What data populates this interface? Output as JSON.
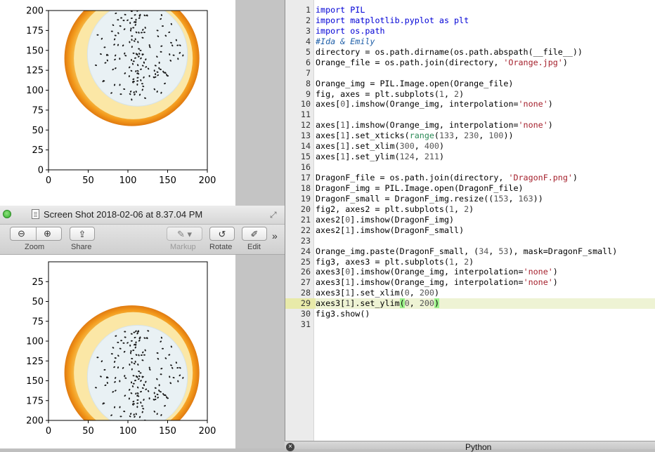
{
  "plot_top": {
    "chart_data": {
      "type": "image",
      "x_ticks": [
        "0",
        "50",
        "100",
        "150",
        "200"
      ],
      "y_ticks": [
        "0",
        "25",
        "50",
        "75",
        "100",
        "125",
        "150",
        "175",
        "200"
      ],
      "xlim": [
        0,
        200
      ],
      "ylim": [
        200,
        0
      ]
    },
    "image_icon": "orange-with-dragonfruit-image"
  },
  "plot_bottom": {
    "chart_data": {
      "type": "image",
      "x_ticks": [
        "0",
        "50",
        "100",
        "150",
        "200"
      ],
      "y_ticks": [
        "200",
        "175",
        "150",
        "125",
        "100",
        "75",
        "50",
        "25"
      ],
      "xlim": [
        0,
        200
      ],
      "ylim": [
        0,
        200
      ]
    },
    "image_icon": "orange-with-dragonfruit-image"
  },
  "preview": {
    "title": "Screen Shot 2018-02-06 at 8.37.04 PM",
    "toolbar": {
      "zoom_label": "Zoom",
      "share_label": "Share",
      "markup_label": "Markup",
      "rotate_label": "Rotate",
      "edit_label": "Edit"
    }
  },
  "editor": {
    "line_numbers": [
      "1",
      "2",
      "3",
      "4",
      "5",
      "6",
      "7",
      "8",
      "9",
      "10",
      "11",
      "12",
      "13",
      "14",
      "15",
      "16",
      "17",
      "18",
      "19",
      "20",
      "21",
      "22",
      "23",
      "24",
      "25",
      "26",
      "27",
      "28",
      "29",
      "30",
      "31"
    ],
    "lines": [
      [
        [
          "kw",
          "import PIL"
        ]
      ],
      [
        [
          "kw",
          "import matplotlib.pyplot as plt"
        ]
      ],
      [
        [
          "kw",
          "import os.path"
        ]
      ],
      [
        [
          "cm",
          "#Ida & Emily"
        ]
      ],
      [
        [
          "tx",
          "directory = os.path.dirname(os.path.abspath(__file__))"
        ]
      ],
      [
        [
          "tx",
          "Orange_file = os.path.join(directory, "
        ],
        [
          "st",
          "'Orange.jpg'"
        ],
        [
          "tx",
          ")"
        ]
      ],
      [],
      [
        [
          "tx",
          "Orange_img = PIL.Image.open(Orange_file)"
        ]
      ],
      [
        [
          "tx",
          "fig, axes = plt.subplots("
        ],
        [
          "nm",
          "1"
        ],
        [
          "tx",
          ", "
        ],
        [
          "nm",
          "2"
        ],
        [
          "tx",
          ")"
        ]
      ],
      [
        [
          "tx",
          "axes["
        ],
        [
          "nm",
          "0"
        ],
        [
          "tx",
          "].imshow(Orange_img, interpolation="
        ],
        [
          "st",
          "'none'"
        ],
        [
          "tx",
          ")"
        ]
      ],
      [],
      [
        [
          "tx",
          "axes["
        ],
        [
          "nm",
          "1"
        ],
        [
          "tx",
          "].imshow(Orange_img, interpolation="
        ],
        [
          "st",
          "'none'"
        ],
        [
          "tx",
          ")"
        ]
      ],
      [
        [
          "tx",
          "axes["
        ],
        [
          "nm",
          "1"
        ],
        [
          "tx",
          "].set_xticks("
        ],
        [
          "bi",
          "range"
        ],
        [
          "tx",
          "("
        ],
        [
          "nm",
          "133"
        ],
        [
          "tx",
          ", "
        ],
        [
          "nm",
          "230"
        ],
        [
          "tx",
          ", "
        ],
        [
          "nm",
          "100"
        ],
        [
          "tx",
          "))"
        ]
      ],
      [
        [
          "tx",
          "axes["
        ],
        [
          "nm",
          "1"
        ],
        [
          "tx",
          "].set_xlim("
        ],
        [
          "nm",
          "300"
        ],
        [
          "tx",
          ", "
        ],
        [
          "nm",
          "400"
        ],
        [
          "tx",
          ")"
        ]
      ],
      [
        [
          "tx",
          "axes["
        ],
        [
          "nm",
          "1"
        ],
        [
          "tx",
          "].set_ylim("
        ],
        [
          "nm",
          "124"
        ],
        [
          "tx",
          ", "
        ],
        [
          "nm",
          "211"
        ],
        [
          "tx",
          ")"
        ]
      ],
      [],
      [
        [
          "tx",
          "DragonF_file = os.path.join(directory, "
        ],
        [
          "st",
          "'DragonF.png'"
        ],
        [
          "tx",
          ")"
        ]
      ],
      [
        [
          "tx",
          "DragonF_img = PIL.Image.open(DragonF_file)"
        ]
      ],
      [
        [
          "tx",
          "DragonF_small = DragonF_img.resize(("
        ],
        [
          "nm",
          "153"
        ],
        [
          "tx",
          ", "
        ],
        [
          "nm",
          "163"
        ],
        [
          "tx",
          "))"
        ]
      ],
      [
        [
          "tx",
          "fig2, axes2 = plt.subplots("
        ],
        [
          "nm",
          "1"
        ],
        [
          "tx",
          ", "
        ],
        [
          "nm",
          "2"
        ],
        [
          "tx",
          ")"
        ]
      ],
      [
        [
          "tx",
          "axes2["
        ],
        [
          "nm",
          "0"
        ],
        [
          "tx",
          "].imshow(DragonF_img)"
        ]
      ],
      [
        [
          "tx",
          "axes2["
        ],
        [
          "nm",
          "1"
        ],
        [
          "tx",
          "].imshow(DragonF_small)"
        ]
      ],
      [],
      [
        [
          "tx",
          "Orange_img.paste(DragonF_small, ("
        ],
        [
          "nm",
          "34"
        ],
        [
          "tx",
          ", "
        ],
        [
          "nm",
          "53"
        ],
        [
          "tx",
          "), mask=DragonF_small)"
        ]
      ],
      [
        [
          "tx",
          "fig3, axes3 = plt.subplots("
        ],
        [
          "nm",
          "1"
        ],
        [
          "tx",
          ", "
        ],
        [
          "nm",
          "2"
        ],
        [
          "tx",
          ")"
        ]
      ],
      [
        [
          "tx",
          "axes3["
        ],
        [
          "nm",
          "0"
        ],
        [
          "tx",
          "].imshow(Orange_img, interpolation="
        ],
        [
          "st",
          "'none'"
        ],
        [
          "tx",
          ")"
        ]
      ],
      [
        [
          "tx",
          "axes3["
        ],
        [
          "nm",
          "1"
        ],
        [
          "tx",
          "].imshow(Orange_img, interpolation="
        ],
        [
          "st",
          "'none'"
        ],
        [
          "tx",
          ")"
        ]
      ],
      [
        [
          "tx",
          "axes3["
        ],
        [
          "nm",
          "1"
        ],
        [
          "tx",
          "].set_xlim("
        ],
        [
          "nm",
          "0"
        ],
        [
          "tx",
          ", "
        ],
        [
          "nm",
          "200"
        ],
        [
          "tx",
          ")"
        ]
      ],
      [
        [
          "tx",
          "axes3["
        ],
        [
          "nm",
          "1"
        ],
        [
          "tx",
          "].set_ylim"
        ],
        [
          "pm",
          "("
        ],
        [
          "nm",
          "0"
        ],
        [
          "tx",
          ", "
        ],
        [
          "nm",
          "200"
        ],
        [
          "pm",
          ")"
        ]
      ],
      [
        [
          "tx",
          "fig3.show()"
        ]
      ],
      []
    ],
    "highlighted_line": 29
  },
  "status": {
    "title": "Python"
  },
  "colors": {
    "orange_peel": "#f0a020",
    "dragonfruit_flesh": "#e9f1f4",
    "seed": "#1a1a1a",
    "keyword": "#0000d6",
    "string": "#a5202c",
    "comment": "#1f5fa8"
  }
}
